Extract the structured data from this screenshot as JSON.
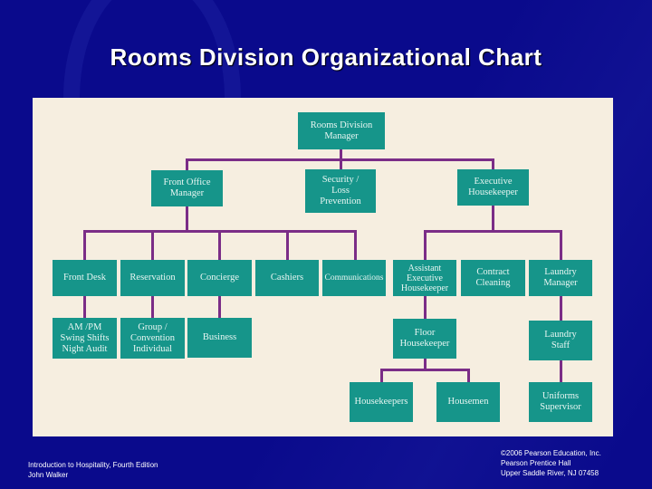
{
  "slide": {
    "title": "Rooms Division Organizational Chart",
    "footer_left": "Introduction to Hospitality, Fourth Edition\nJohn Walker",
    "footer_right": "©2006 Pearson Education, Inc.\nPearson Prentice Hall\nUpper Saddle River, NJ 07458"
  },
  "colors": {
    "background": "#0a0a8c",
    "panel": "#f6eee0",
    "box": "#16958a",
    "connector": "#7b2d87",
    "title_text": "#ffffff"
  },
  "org_chart": {
    "root": "Rooms Division Manager",
    "level1": [
      "Front Office Manager",
      "Security /\nLoss\nPrevention",
      "Executive\nHousekeeper"
    ],
    "front_office_children": [
      "Front Desk",
      "Reservation",
      "Concierge",
      "Cashiers",
      "Communications"
    ],
    "front_office_grandchildren": {
      "front_desk": "AM /PM\nSwing Shifts\nNight Audit",
      "reservation": "Group /\nConvention\nIndividual",
      "concierge": "Business"
    },
    "housekeeping_children": [
      "Assistant\nExecutive\nHousekeeper",
      "Contract\nCleaning",
      "Laundry\nManager"
    ],
    "assistant_exec_child": "Floor\nHousekeeper",
    "floor_housekeeper_children": [
      "Housekeepers",
      "Housemen"
    ],
    "laundry_manager_child": "Laundry\nStaff",
    "laundry_staff_child": "Uniforms\nSupervisor"
  }
}
